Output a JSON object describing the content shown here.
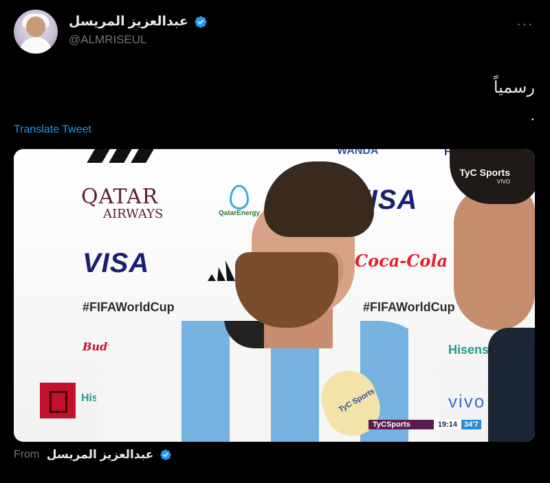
{
  "tweet": {
    "author": {
      "display_name": "عبدالعزيز المريسل",
      "handle": "@ALMRISEUL",
      "verified_icon": "verified-badge-icon",
      "avatar_icon": "avatar"
    },
    "more_label": "···",
    "text": "رسمياً\n.",
    "translate_label": "Translate Tweet",
    "media": {
      "broadcast_logo": "TyC Sports",
      "broadcast_sub": "VIVO",
      "sponsor_qatar_line1": "QATAR",
      "sponsor_qatar_line2": "AIRWAYS",
      "sponsor_visa": "VISA",
      "hashtag": "#FIFAWorldCup",
      "sponsor_budweiser": "Budweiser",
      "sponsor_cocacola": "Coca-Cola",
      "sponsor_hisense": "Hisense",
      "sponsor_hisense_partial": "His",
      "sponsor_vivo": "vivo",
      "sponsor_wanda": "WANDA",
      "sponsor_hyundai": "HYUN",
      "sponsor_qatarenergy": "QatarEnergy",
      "mic_label": "TyC Sports",
      "scorebug_brand": "TyCSports",
      "scorebug_time": "19:14",
      "scorebug_period": "34'7"
    },
    "source": {
      "from_label": "From",
      "from_name": "عبدالعزيز المريسل"
    }
  },
  "colors": {
    "background": "#000000",
    "text_primary": "#e7e9ea",
    "text_secondary": "#71767b",
    "link": "#1d9bf0",
    "verified": "#1d9bf0"
  }
}
